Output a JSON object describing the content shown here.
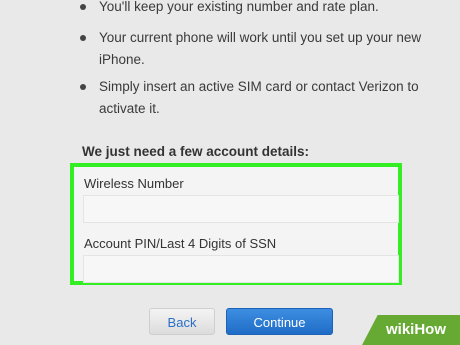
{
  "bullets": [
    "You'll keep your existing number and rate plan.",
    "Your current phone will work until you set up your new iPhone.",
    "Simply insert an active SIM card or contact Verizon to activate it."
  ],
  "section_heading": "We just need a few account details:",
  "form": {
    "wireless_label": "Wireless Number",
    "wireless_value": "",
    "pin_label": "Account PIN/Last 4 Digits of SSN",
    "pin_value": ""
  },
  "buttons": {
    "back": "Back",
    "continue": "Continue"
  },
  "watermark": {
    "wiki": "wiki",
    "how": "How"
  },
  "colors": {
    "highlight_border": "#33ee22",
    "primary_button": "#2677d3",
    "watermark_bg": "#66aa33"
  }
}
